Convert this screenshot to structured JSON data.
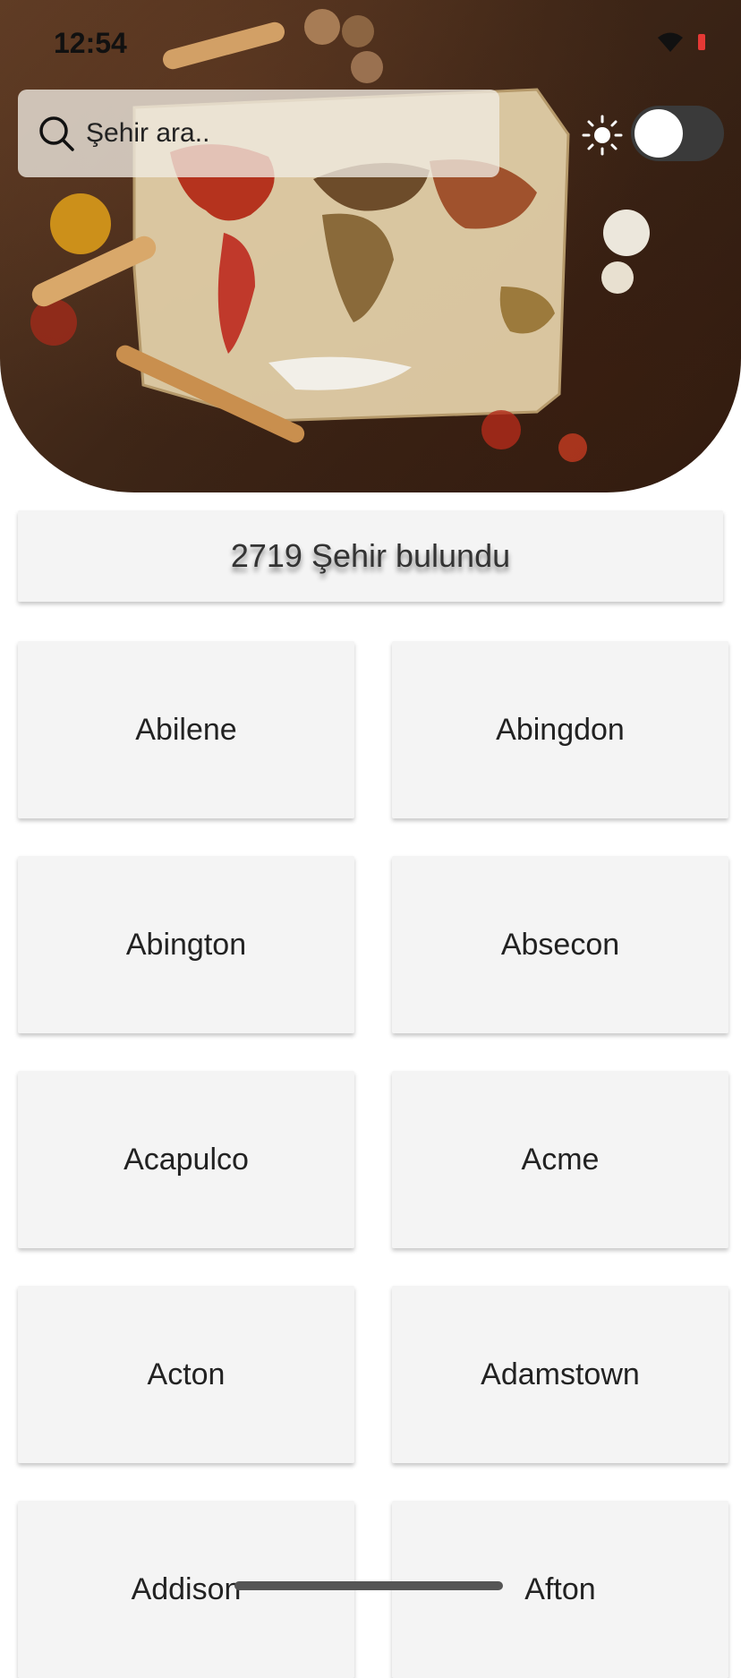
{
  "status_bar": {
    "time": "12:54"
  },
  "search": {
    "placeholder": "Şehir ara.."
  },
  "theme_toggle": {
    "on": false
  },
  "result": {
    "count_text": "2719 Şehir bulundu"
  },
  "cities": [
    "Abilene",
    "Abingdon",
    "Abington",
    "Absecon",
    "Acapulco",
    "Acme",
    "Acton",
    "Adamstown",
    "Addison",
    "Afton"
  ],
  "colors": {
    "accent_battery": "#e53935",
    "toggle_track": "#3a3a3a",
    "card_bg": "#f4f4f4"
  }
}
